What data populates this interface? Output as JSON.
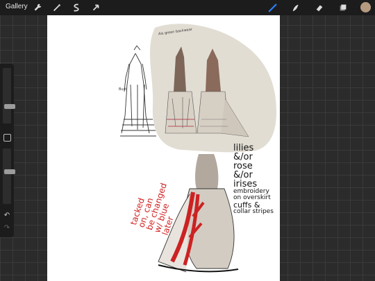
{
  "topbar": {
    "gallery_label": "Gallery",
    "tools": [
      "wrench-icon",
      "magic-wand-icon",
      "selection-icon",
      "transform-icon"
    ],
    "draw_tools": [
      "brush-icon",
      "smudge-icon",
      "eraser-icon",
      "layers-icon"
    ],
    "active_tool": "brush-icon",
    "current_color": "#b59a80",
    "accent": "#2d7fff"
  },
  "sidebar": {
    "size_slider_level": 0.45,
    "opacity_slider_level": 0.45,
    "modify_button": "square-icon",
    "undo": "undo-icon",
    "redo": "redo-icon"
  },
  "canvas": {
    "annotations": {
      "top_small": "Ais green backwear",
      "top_small2": "Bust",
      "red_note": [
        "tacked",
        "on, can",
        "be changed",
        "w/ blue",
        "later"
      ],
      "black_note": [
        "lilies",
        "&/or",
        "rose",
        "&/or",
        "irises",
        "embroidery",
        "on overskirt",
        "cuffs &",
        "collar stripes"
      ]
    }
  }
}
